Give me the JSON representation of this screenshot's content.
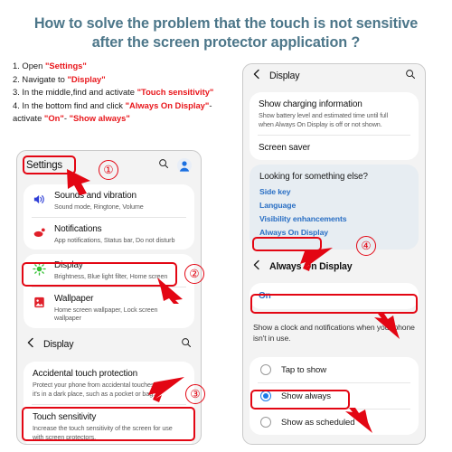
{
  "title": {
    "line1": "How to solve the problem that the touch is not sensitive",
    "line2": "after  the screen protector application ?"
  },
  "steps": [
    {
      "num": "1. Open ",
      "hl1": "\"Settings\"",
      "tail": ""
    },
    {
      "num": "2. Navigate to ",
      "hl1": "\"Display\"",
      "tail": ""
    },
    {
      "num": "3. In the middle,find and activate ",
      "hl1": "\"Touch sensitivity\"",
      "tail": ""
    },
    {
      "num": "4. In the bottom find and click ",
      "hl1": "\"Always On Display\"",
      "tail": "-"
    },
    {
      "num": "activate ",
      "hl1": "\"On\"",
      "mid": "- ",
      "hl2": "\"Show always\"",
      "tail": ""
    }
  ],
  "left_phone": {
    "header": {
      "title": "Settings",
      "search_icon": "search-icon",
      "avatar_icon": "account-avatar-icon"
    },
    "group1": [
      {
        "icon": "volume-icon",
        "title": "Sounds and vibration",
        "subtitle": "Sound mode, Ringtone, Volume"
      },
      {
        "icon": "notifications-icon",
        "title": "Notifications",
        "subtitle": "App notifications, Status bar, Do not disturb"
      }
    ],
    "group2": [
      {
        "icon": "brightness-icon",
        "title": "Display",
        "subtitle": "Brightness, Blue light filter, Home screen"
      },
      {
        "icon": "wallpaper-icon",
        "title": "Wallpaper",
        "subtitle": "Home screen wallpaper, Lock screen wallpaper"
      }
    ],
    "display_header": {
      "back_icon": "back-chevron-icon",
      "title": "Display",
      "search_icon": "search-icon"
    },
    "display_items": [
      {
        "title": "Accidental touch protection",
        "subtitle": "Protect your phone from accidental touches when it's in a dark place, such as a pocket or bag.",
        "toggle": "on"
      },
      {
        "title": "Touch sensitivity",
        "subtitle": "Increase the touch sensitivity of the screen for use with screen protectors.",
        "toggle": "on"
      }
    ]
  },
  "right_phone": {
    "display_header": {
      "back_icon": "back-chevron-icon",
      "title": "Display",
      "search_icon": "search-icon"
    },
    "charging": {
      "title": "Show charging information",
      "subtitle": "Show battery level and estimated time until full when Always On Display is off or not shown.",
      "toggle": "on"
    },
    "screen_saver": "Screen saver",
    "looking": {
      "heading": "Looking for something else?",
      "links": [
        "Side key",
        "Language",
        "Visibility enhancements",
        "Always On Display"
      ]
    },
    "aod_header": {
      "back_icon": "back-chevron-icon",
      "title": "Always On Display"
    },
    "aod_toggle": {
      "label": "On",
      "toggle": "on"
    },
    "aod_desc": "Show a clock and notifications when your phone isn't in use.",
    "aod_options": [
      {
        "label": "Tap to show",
        "selected": false
      },
      {
        "label": "Show always",
        "selected": true
      },
      {
        "label": "Show as scheduled",
        "selected": false
      }
    ]
  },
  "annotations": {
    "markers": [
      "①",
      "②",
      "③",
      "④"
    ]
  },
  "colors": {
    "title": "#4c7689",
    "highlight_red": "#e8161b",
    "annotation_red": "#e30613",
    "toggle_blue": "#1a7ae8",
    "link_blue": "#2a6fc4"
  }
}
